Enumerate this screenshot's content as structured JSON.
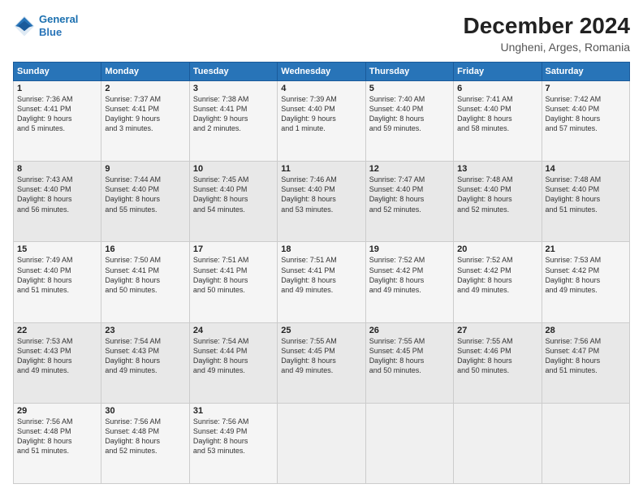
{
  "header": {
    "logo_line1": "General",
    "logo_line2": "Blue",
    "title": "December 2024",
    "subtitle": "Ungheni, Arges, Romania"
  },
  "weekdays": [
    "Sunday",
    "Monday",
    "Tuesday",
    "Wednesday",
    "Thursday",
    "Friday",
    "Saturday"
  ],
  "weeks": [
    [
      {
        "day": "1",
        "info": "Sunrise: 7:36 AM\nSunset: 4:41 PM\nDaylight: 9 hours\nand 5 minutes."
      },
      {
        "day": "2",
        "info": "Sunrise: 7:37 AM\nSunset: 4:41 PM\nDaylight: 9 hours\nand 3 minutes."
      },
      {
        "day": "3",
        "info": "Sunrise: 7:38 AM\nSunset: 4:41 PM\nDaylight: 9 hours\nand 2 minutes."
      },
      {
        "day": "4",
        "info": "Sunrise: 7:39 AM\nSunset: 4:40 PM\nDaylight: 9 hours\nand 1 minute."
      },
      {
        "day": "5",
        "info": "Sunrise: 7:40 AM\nSunset: 4:40 PM\nDaylight: 8 hours\nand 59 minutes."
      },
      {
        "day": "6",
        "info": "Sunrise: 7:41 AM\nSunset: 4:40 PM\nDaylight: 8 hours\nand 58 minutes."
      },
      {
        "day": "7",
        "info": "Sunrise: 7:42 AM\nSunset: 4:40 PM\nDaylight: 8 hours\nand 57 minutes."
      }
    ],
    [
      {
        "day": "8",
        "info": "Sunrise: 7:43 AM\nSunset: 4:40 PM\nDaylight: 8 hours\nand 56 minutes."
      },
      {
        "day": "9",
        "info": "Sunrise: 7:44 AM\nSunset: 4:40 PM\nDaylight: 8 hours\nand 55 minutes."
      },
      {
        "day": "10",
        "info": "Sunrise: 7:45 AM\nSunset: 4:40 PM\nDaylight: 8 hours\nand 54 minutes."
      },
      {
        "day": "11",
        "info": "Sunrise: 7:46 AM\nSunset: 4:40 PM\nDaylight: 8 hours\nand 53 minutes."
      },
      {
        "day": "12",
        "info": "Sunrise: 7:47 AM\nSunset: 4:40 PM\nDaylight: 8 hours\nand 52 minutes."
      },
      {
        "day": "13",
        "info": "Sunrise: 7:48 AM\nSunset: 4:40 PM\nDaylight: 8 hours\nand 52 minutes."
      },
      {
        "day": "14",
        "info": "Sunrise: 7:48 AM\nSunset: 4:40 PM\nDaylight: 8 hours\nand 51 minutes."
      }
    ],
    [
      {
        "day": "15",
        "info": "Sunrise: 7:49 AM\nSunset: 4:40 PM\nDaylight: 8 hours\nand 51 minutes."
      },
      {
        "day": "16",
        "info": "Sunrise: 7:50 AM\nSunset: 4:41 PM\nDaylight: 8 hours\nand 50 minutes."
      },
      {
        "day": "17",
        "info": "Sunrise: 7:51 AM\nSunset: 4:41 PM\nDaylight: 8 hours\nand 50 minutes."
      },
      {
        "day": "18",
        "info": "Sunrise: 7:51 AM\nSunset: 4:41 PM\nDaylight: 8 hours\nand 49 minutes."
      },
      {
        "day": "19",
        "info": "Sunrise: 7:52 AM\nSunset: 4:42 PM\nDaylight: 8 hours\nand 49 minutes."
      },
      {
        "day": "20",
        "info": "Sunrise: 7:52 AM\nSunset: 4:42 PM\nDaylight: 8 hours\nand 49 minutes."
      },
      {
        "day": "21",
        "info": "Sunrise: 7:53 AM\nSunset: 4:42 PM\nDaylight: 8 hours\nand 49 minutes."
      }
    ],
    [
      {
        "day": "22",
        "info": "Sunrise: 7:53 AM\nSunset: 4:43 PM\nDaylight: 8 hours\nand 49 minutes."
      },
      {
        "day": "23",
        "info": "Sunrise: 7:54 AM\nSunset: 4:43 PM\nDaylight: 8 hours\nand 49 minutes."
      },
      {
        "day": "24",
        "info": "Sunrise: 7:54 AM\nSunset: 4:44 PM\nDaylight: 8 hours\nand 49 minutes."
      },
      {
        "day": "25",
        "info": "Sunrise: 7:55 AM\nSunset: 4:45 PM\nDaylight: 8 hours\nand 49 minutes."
      },
      {
        "day": "26",
        "info": "Sunrise: 7:55 AM\nSunset: 4:45 PM\nDaylight: 8 hours\nand 50 minutes."
      },
      {
        "day": "27",
        "info": "Sunrise: 7:55 AM\nSunset: 4:46 PM\nDaylight: 8 hours\nand 50 minutes."
      },
      {
        "day": "28",
        "info": "Sunrise: 7:56 AM\nSunset: 4:47 PM\nDaylight: 8 hours\nand 51 minutes."
      }
    ],
    [
      {
        "day": "29",
        "info": "Sunrise: 7:56 AM\nSunset: 4:48 PM\nDaylight: 8 hours\nand 51 minutes."
      },
      {
        "day": "30",
        "info": "Sunrise: 7:56 AM\nSunset: 4:48 PM\nDaylight: 8 hours\nand 52 minutes."
      },
      {
        "day": "31",
        "info": "Sunrise: 7:56 AM\nSunset: 4:49 PM\nDaylight: 8 hours\nand 53 minutes."
      },
      {
        "day": "",
        "info": ""
      },
      {
        "day": "",
        "info": ""
      },
      {
        "day": "",
        "info": ""
      },
      {
        "day": "",
        "info": ""
      }
    ]
  ]
}
